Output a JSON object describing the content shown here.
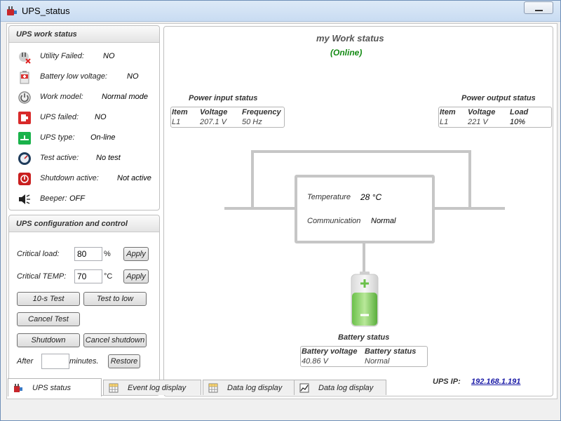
{
  "window": {
    "title": "UPS_status"
  },
  "work_status": {
    "header": "UPS work status",
    "items": [
      {
        "label": "Utility Failed:",
        "value": "NO",
        "icon": "plug-icon"
      },
      {
        "label": "Battery low voltage:",
        "value": "NO",
        "icon": "battery-low-icon"
      },
      {
        "label": "Work model:",
        "value": "Normal mode",
        "icon": "power-icon"
      },
      {
        "label": "UPS failed:",
        "value": "NO",
        "icon": "ups-failed-icon"
      },
      {
        "label": "UPS type:",
        "value": "On-line",
        "icon": "ups-type-icon"
      },
      {
        "label": "Test active:",
        "value": "No test",
        "icon": "gauge-icon"
      },
      {
        "label": "Shutdown active:",
        "value": "Not active",
        "icon": "shutdown-icon"
      },
      {
        "label": "Beeper:",
        "value": "OFF",
        "icon": "speaker-icon"
      }
    ]
  },
  "config": {
    "header": "UPS configuration and control",
    "critical_load_label": "Critical load:",
    "critical_load_value": "80",
    "critical_load_unit": "%",
    "critical_temp_label": "Critical TEMP:",
    "critical_temp_value": "70",
    "critical_temp_unit": "°C",
    "apply_label": "Apply",
    "test10_label": "10-s Test",
    "test_low_label": "Test to low",
    "cancel_test_label": "Cancel Test",
    "shutdown_label": "Shutdown",
    "cancel_shutdown_label": "Cancel shutdown",
    "after_label": "After",
    "minutes_value": "",
    "minutes_label": "minutes.",
    "restore_label": "Restore"
  },
  "main": {
    "title": "my Work status",
    "status": "(Online)",
    "status_color": "#138a13",
    "input": {
      "title": "Power input status",
      "headers": [
        "Item",
        "Voltage",
        "Frequency"
      ],
      "row": [
        "L1",
        "207.1 V",
        "50 Hz"
      ]
    },
    "output": {
      "title": "Power output status",
      "headers": [
        "Item",
        "Voltage",
        "Load"
      ],
      "row": [
        "L1",
        "221 V",
        "10%"
      ]
    },
    "temperature_label": "Temperature",
    "temperature_value": "28 °C",
    "communication_label": "Communication",
    "communication_value": "Normal",
    "battery": {
      "title": "Battery status",
      "headers": [
        "Battery voltage",
        "Battery status"
      ],
      "row": [
        "40.86 V",
        "Normal"
      ],
      "icon": "battery-icon"
    },
    "ups_ip_label": "UPS IP:",
    "ups_ip_value": "192.168.1.191",
    "link_color": "#1a1aa6"
  },
  "tabs": [
    {
      "label": "UPS status",
      "icon": "ups-tab-icon",
      "active": true
    },
    {
      "label": "Event log display",
      "icon": "grid-icon",
      "active": false
    },
    {
      "label": "Data log display",
      "icon": "grid-icon",
      "active": false
    },
    {
      "label": "Data log display",
      "icon": "chart-icon",
      "active": false
    }
  ]
}
